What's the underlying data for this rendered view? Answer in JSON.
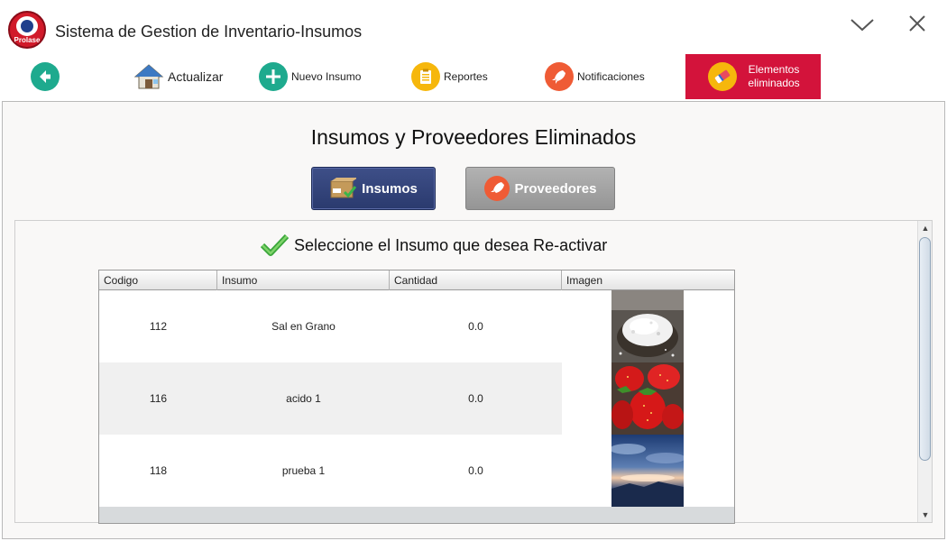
{
  "window": {
    "title": "Sistema de Gestion de Inventario-Insumos",
    "logo_text": "Prolase"
  },
  "toolbar": {
    "back_icon": "arrow-left-icon",
    "items": [
      {
        "label": "Actualizar",
        "icon": "house-icon"
      },
      {
        "label": "Nuevo Insumo",
        "icon": "plus-icon"
      },
      {
        "label": "Reportes",
        "icon": "clipboard-icon"
      },
      {
        "label": "Notificaciones",
        "icon": "rocket-icon"
      },
      {
        "label": "Elementos eliminados",
        "icon": "eraser-icon",
        "active": true,
        "active_color": "#d3133b"
      }
    ]
  },
  "main": {
    "title": "Insumos y Proveedores Eliminados",
    "tabs": [
      {
        "label": "Insumos",
        "icon": "package-icon",
        "selected": true,
        "color": "#34437a"
      },
      {
        "label": "Proveedores",
        "icon": "rocket-icon",
        "selected": false,
        "color": "#a3a3a3"
      }
    ],
    "instruction": "Seleccione el Insumo que desea Re-activar",
    "table": {
      "columns": [
        "Codigo",
        "Insumo",
        "Cantidad",
        "Imagen"
      ],
      "rows": [
        {
          "codigo": "112",
          "insumo": "Sal en Grano",
          "cantidad": "0.0",
          "imagen": "salt-image"
        },
        {
          "codigo": "116",
          "insumo": "acido 1",
          "cantidad": "0.0",
          "imagen": "strawberries-image"
        },
        {
          "codigo": "118",
          "insumo": "prueba 1",
          "cantidad": "0.0",
          "imagen": "sunset-sky-image"
        }
      ]
    }
  }
}
